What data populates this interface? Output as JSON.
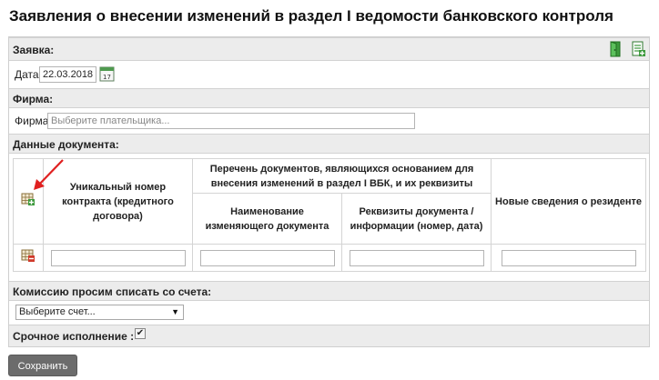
{
  "page": {
    "title": "Заявления о внесении изменений в раздел I ведомости банковского контроля"
  },
  "application": {
    "section_label": "Заявка:",
    "date_label": "Дата",
    "date_value": "22.03.2018",
    "calendar_day": "17",
    "icons": [
      "exit-door-icon",
      "excel-export-icon"
    ]
  },
  "firm": {
    "section_label": "Фирма:",
    "field_label": "Фирма",
    "placeholder": "Выберите плательщика..."
  },
  "document": {
    "section_label": "Данные документа:",
    "columns": {
      "contract": "Уникальный номер контракта (кредитного договора)",
      "docs_group": "Перечень документов, являющихся основанием для внесения изменений в раздел I ВБК, и их реквизиты",
      "doc_name": "Наименование изменяющего документа",
      "doc_details": "Реквизиты документа / информации (номер, дата)",
      "new_info": "Новые сведения о резиденте"
    },
    "rows": [
      {
        "contract": "",
        "doc_name": "",
        "doc_details": "",
        "new_info": ""
      }
    ]
  },
  "commission": {
    "section_label": "Комиссию просим списать со счета:",
    "select_value": "Выберите счет..."
  },
  "urgent": {
    "label": "Срочное исполнение :",
    "checked": true
  },
  "actions": {
    "save_label": "Сохранить"
  },
  "colors": {
    "section_bg": "#ececec",
    "border": "#cfcfcf",
    "save_button": "#6c6c6c",
    "arrow": "#e02020",
    "icon_green": "#3d9a3d"
  }
}
